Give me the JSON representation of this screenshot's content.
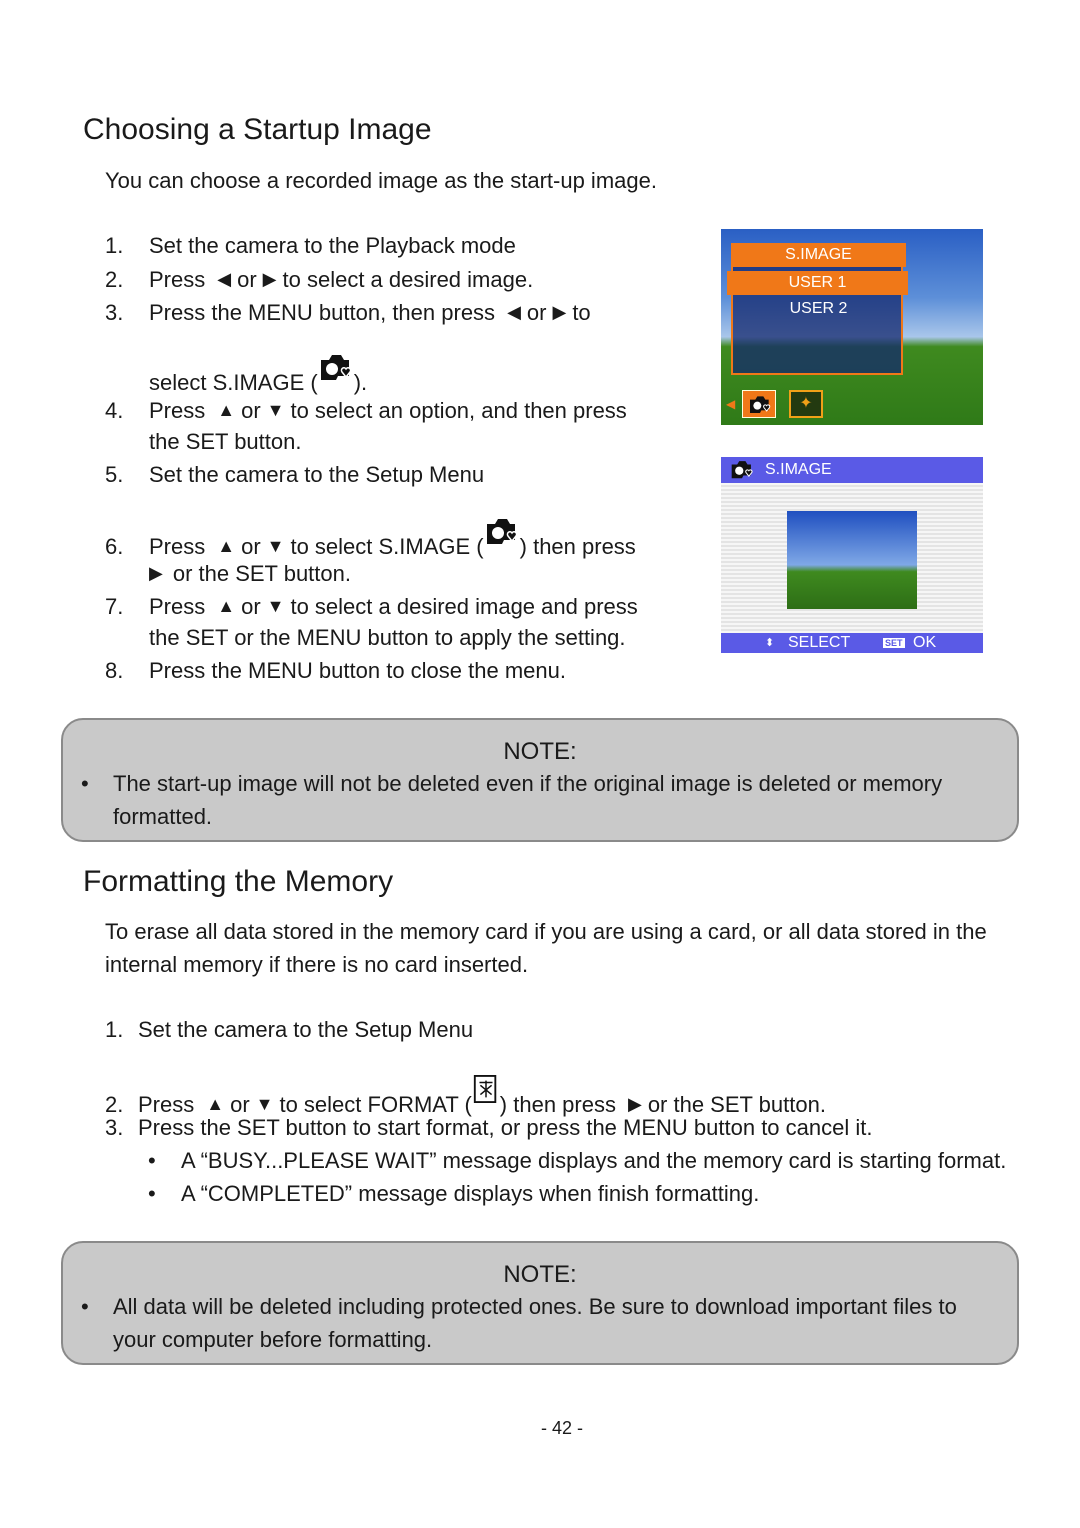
{
  "s1": {
    "title": "Choosing a Startup Image",
    "intro": "You can choose a recorded image as the start-up image.",
    "steps": [
      {
        "n": "1.",
        "a": "Set the camera to the Playback mode"
      },
      {
        "n": "2.",
        "a": "Press",
        "b": "or",
        "c": "to select a desired image."
      },
      {
        "n": "3.",
        "a": "Press the MENU button, then press",
        "b": "or",
        "c": "to",
        "d": "select S.IMAGE (",
        "e": ")."
      },
      {
        "n": "4.",
        "a": "Press",
        "b": "or",
        "c": "to select an option, and then press",
        "d": "the SET button."
      },
      {
        "n": "5.",
        "a": "Set the camera to the Setup Menu"
      },
      {
        "n": "6.",
        "a": "Press",
        "b": "or",
        "c": "to select S.IMAGE (",
        "d": ") then press",
        "e": "or the SET button."
      },
      {
        "n": "7.",
        "a": "Press",
        "b": "or",
        "c": "to select a desired image and press",
        "d": "the SET or the MENU button to apply the setting."
      },
      {
        "n": "8.",
        "a": "Press the MENU button to close the menu."
      }
    ],
    "note_title": "NOTE:",
    "note_text1": "The start-up image will not be deleted even if the original image is deleted or memory",
    "note_text2": "formatted."
  },
  "screen1": {
    "title": "S.IMAGE",
    "items": [
      "USER 1",
      "USER 2"
    ],
    "selected": "USER 1"
  },
  "screen2": {
    "title": "S.IMAGE",
    "select": "SELECT",
    "set": "SET",
    "ok": "OK"
  },
  "s2": {
    "title": "Formatting the Memory",
    "para1": "To erase all data stored in the memory card if you are using a card, or all data stored in the",
    "para2": "internal memory if there is no card inserted.",
    "steps": [
      {
        "n": "1.",
        "a": "Set the camera to the Setup Menu"
      },
      {
        "n": "2.",
        "a": "Press",
        "b": "or",
        "c": "to select FORMAT (",
        "d": ") then press",
        "e": "or the SET button."
      },
      {
        "n": "3.",
        "a": "Press the SET button to start format, or press the MENU button to cancel it."
      }
    ],
    "bullets": [
      "A “BUSY...PLEASE WAIT” message displays and the memory card is starting format.",
      "A “COMPLETED” message displays when finish formatting."
    ],
    "note_title": "NOTE:",
    "note_text1": "All data will be deleted including protected ones. Be sure to download important files to",
    "note_text2": "your computer before formatting."
  },
  "bullet": "•",
  "page_number": "- 42 -",
  "colors": {
    "note_bg": "#c9c9c9",
    "menu_orange": "#f07818",
    "screen_blue": "#5a5ae6"
  }
}
